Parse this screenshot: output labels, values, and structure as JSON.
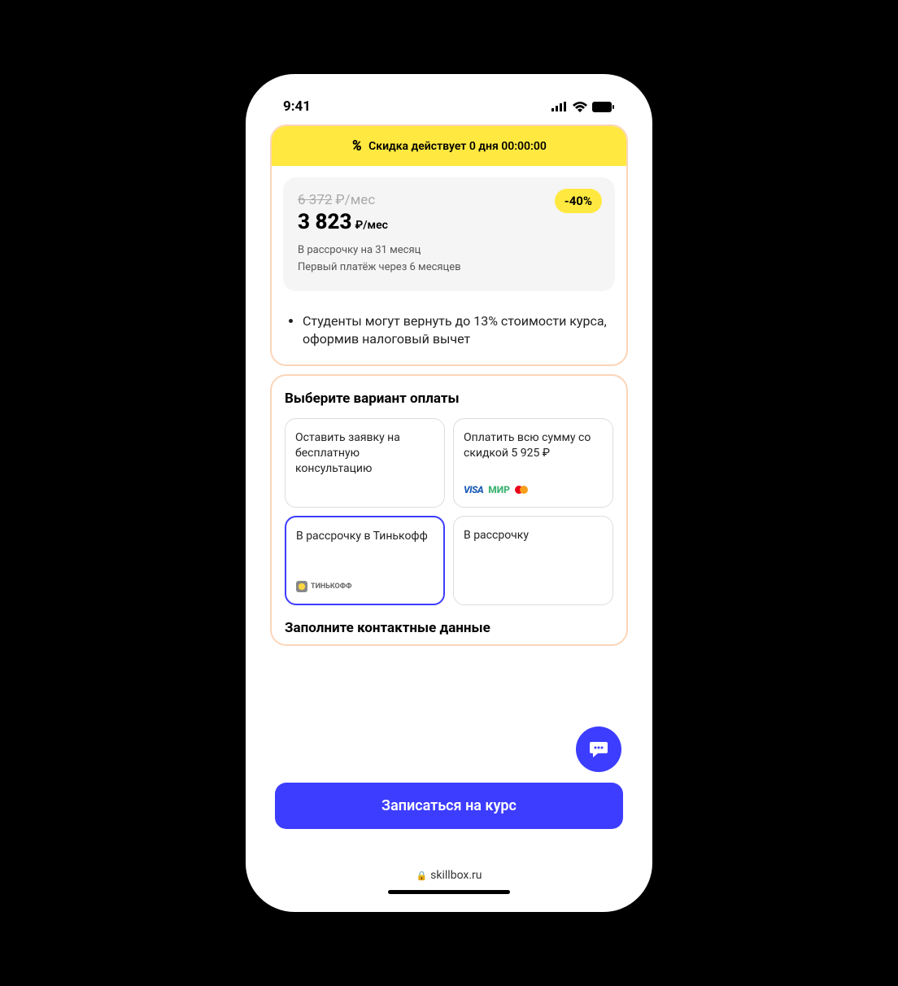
{
  "status": {
    "time": "9:41"
  },
  "discount_banner": {
    "text": "Скидка действует 0 дня 00:00:00"
  },
  "price": {
    "old": "6 372",
    "old_suffix": "₽/мес",
    "new": "3 823",
    "new_suffix": "₽/мес",
    "discount_badge": "-40%",
    "installment": "В рассрочку на 31 месяц",
    "first_payment": "Первый платёж через 6 месяцев"
  },
  "bullet": {
    "text": "Студенты могут вернуть до 13% стоимости курса, оформив налоговый вычет"
  },
  "payment": {
    "title": "Выберите вариант оплаты",
    "options": [
      {
        "text": "Оставить заявку на бесплатную консультацию"
      },
      {
        "text": "Оплатить всю сумму со скидкой 5 925 ₽"
      },
      {
        "text": "В рассрочку в Тинькофф"
      },
      {
        "text": "В рассрочку"
      }
    ]
  },
  "contact": {
    "title": "Заполните контактные данные"
  },
  "cta": {
    "label": "Записаться на курс"
  },
  "browser": {
    "url": "skillbox.ru"
  },
  "logos": {
    "visa": "VISA",
    "mir": "МИР",
    "tinkoff": "ТИНЬКОФФ"
  }
}
